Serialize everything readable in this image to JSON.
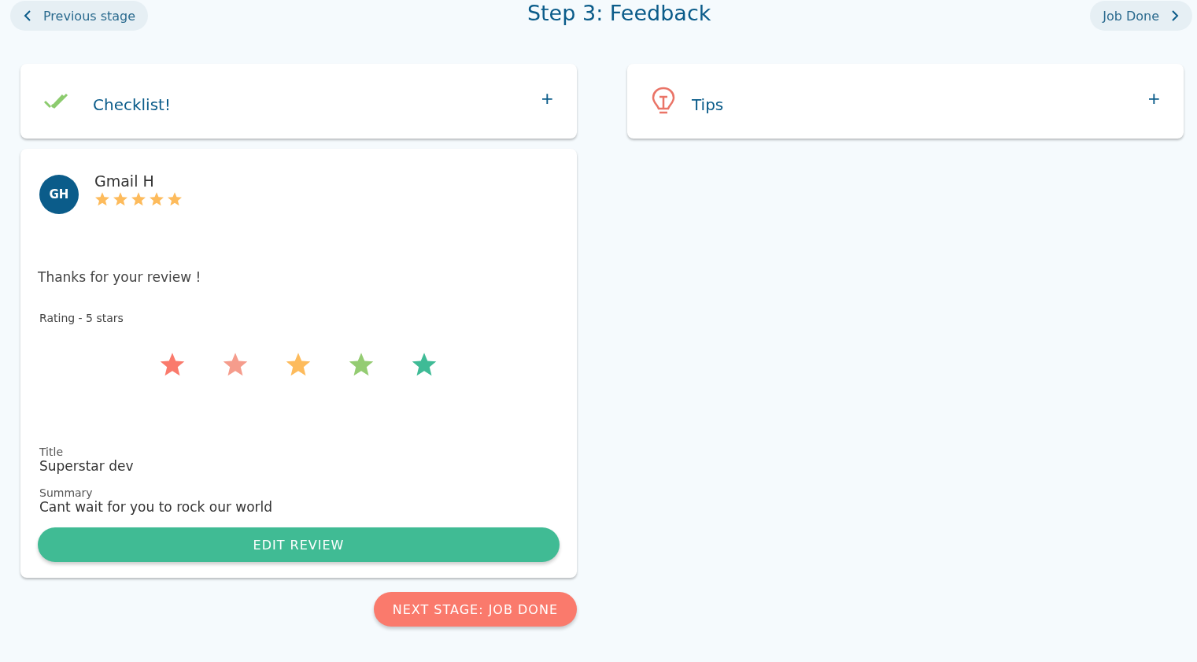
{
  "header": {
    "back_button": "Previous stage",
    "title": "Step 3: Feedback",
    "forward_button": "Job Done"
  },
  "panels": [
    {
      "kind": "checklist",
      "title": "Checklist!",
      "toggle": "+"
    },
    {
      "kind": "tips",
      "title": "Tips",
      "toggle": "+"
    }
  ],
  "review": {
    "avatar": "GH",
    "name": "Gmail H",
    "stars": 5,
    "message": "Thanks for your review !",
    "rating_label": "Rating - 5 stars",
    "rating_scale": [
      {
        "color": "#fa7a6c"
      },
      {
        "color": "#f59c8c"
      },
      {
        "color": "#fdbb5c"
      },
      {
        "color": "#94cc72"
      },
      {
        "color": "#3fbb96"
      }
    ],
    "fields": [
      {
        "label": "Title",
        "value": "Superstar dev"
      },
      {
        "label": "Summary",
        "value": "Cant wait for you to rock our world"
      }
    ],
    "edit_button": "EDIT REVIEW"
  },
  "next_button": "NEXT STAGE: JOB DONE"
}
